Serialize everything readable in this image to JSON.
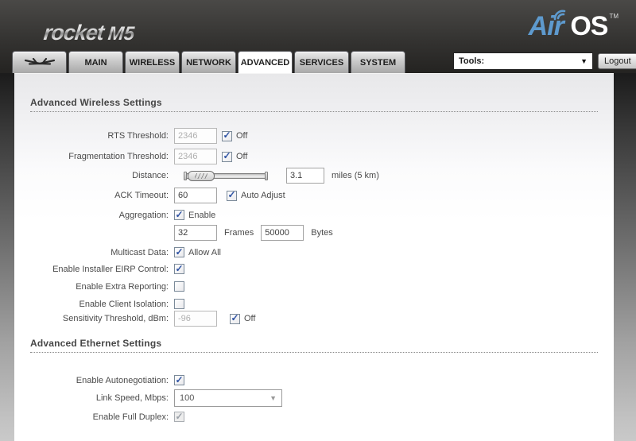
{
  "header": {
    "product": "rocket",
    "model": "M5",
    "brand_air": "Air",
    "brand_os": "OS",
    "brand_tm": "TM"
  },
  "tabs": [
    {
      "label": "",
      "icon": "ubiquiti-logo",
      "active": false
    },
    {
      "label": "MAIN",
      "active": false
    },
    {
      "label": "WIRELESS",
      "active": false
    },
    {
      "label": "NETWORK",
      "active": false
    },
    {
      "label": "ADVANCED",
      "active": true
    },
    {
      "label": "SERVICES",
      "active": false
    },
    {
      "label": "SYSTEM",
      "active": false
    }
  ],
  "toolbar": {
    "tools_label": "Tools:",
    "tools_arrow": "▼",
    "logout_label": "Logout"
  },
  "wireless": {
    "title": "Advanced Wireless Settings",
    "rts": {
      "label": "RTS Threshold:",
      "value": "2346",
      "checked_glyph": "✓",
      "cb_label": "Off"
    },
    "frag": {
      "label": "Fragmentation Threshold:",
      "value": "2346",
      "checked_glyph": "✓",
      "cb_label": "Off"
    },
    "distance": {
      "label": "Distance:",
      "value": "3.1",
      "suffix": "miles (5 km)",
      "slider_pos_pct": 5
    },
    "ack": {
      "label": "ACK Timeout:",
      "value": "60",
      "checked_glyph": "✓",
      "cb_label": "Auto Adjust"
    },
    "aggregation": {
      "label": "Aggregation:",
      "checked_glyph": "✓",
      "cb_label": "Enable",
      "frames_value": "32",
      "frames_label": "Frames",
      "bytes_value": "50000",
      "bytes_label": "Bytes"
    },
    "multicast": {
      "label": "Multicast Data:",
      "checked_glyph": "✓",
      "cb_label": "Allow All"
    },
    "eirp": {
      "label": "Enable Installer EIRP Control:",
      "checked_glyph": "✓"
    },
    "extra_reporting": {
      "label": "Enable Extra Reporting:",
      "checked_glyph": ""
    },
    "client_isolation": {
      "label": "Enable Client Isolation:",
      "checked_glyph": ""
    },
    "sensitivity": {
      "label": "Sensitivity Threshold, dBm:",
      "value": "-96",
      "checked_glyph": "✓",
      "cb_label": "Off"
    }
  },
  "ethernet": {
    "title": "Advanced Ethernet Settings",
    "autoneg": {
      "label": "Enable Autonegotiation:",
      "checked_glyph": "✓"
    },
    "link_speed": {
      "label": "Link Speed, Mbps:",
      "value": "100",
      "arrow": "▼"
    },
    "full_duplex": {
      "label": "Enable Full Duplex:",
      "checked_glyph": "✓"
    }
  }
}
